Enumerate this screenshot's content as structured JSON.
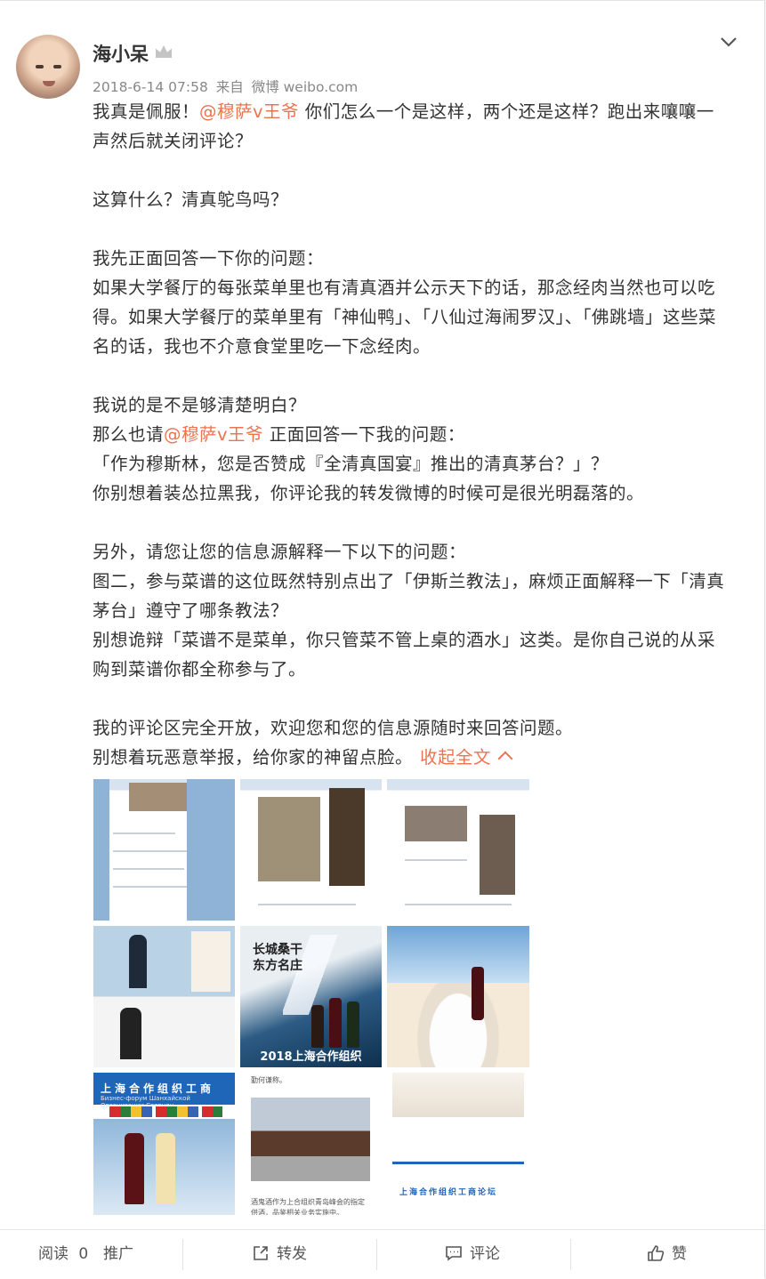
{
  "post": {
    "author": "海小呆",
    "timestamp": "2018-6-14 07:58",
    "source_prefix": "来自",
    "source": "微博 weibo.com",
    "p1_a": "我真是佩服！",
    "mention1": "@穆萨v王爷",
    "p1_b": " 你们怎么一个是这样，两个还是这样？跑出来嚷嚷一声然后就关闭评论？",
    "p2": "这算什么？清真鸵鸟吗？",
    "p3": "我先正面回答一下你的问题：",
    "p4": "如果大学餐厅的每张菜单里也有清真酒并公示天下的话，那念经肉当然也可以吃得。如果大学餐厅的菜单里有「神仙鸭」、「八仙过海闹罗汉」、「佛跳墙」这些菜名的话，我也不介意食堂里吃一下念经肉。",
    "p5": "我说的是不是够清楚明白？",
    "p6_a": "那么也请",
    "mention2": "@穆萨v王爷",
    "p6_b": " 正面回答一下我的问题：",
    "p7": "「作为穆斯林，您是否赞成『全清真国宴』推出的清真茅台？」？",
    "p8": "你别想着装怂拉黑我，你评论我的转发微博的时候可是很光明磊落的。",
    "p9": "另外，请您让您的信息源解释一下以下的问题：",
    "p10": "图二，参与菜谱的这位既然特别点出了「伊斯兰教法」，麻烦正面解释一下「清真茅台」遵守了哪条教法？",
    "p11": "别想诡辩「菜谱不是菜单，你只管菜不管上桌的酒水」这类。是你自己说的从采购到菜谱你都全称参与了。",
    "p12": "我的评论区完全开放，欢迎您和您的信息源随时来回答问题。",
    "p13": "别想着玩恶意举报，给你家的神留点脸。",
    "collapse_label": "收起全文"
  },
  "images": {
    "poster_cn": "长城桑干\n东方名庄",
    "poster_year": "2018上海合作组织",
    "sco_title": "上海合作组织工商",
    "sco_sub": "Бизнес-форум Шанхайской Организации Сотрудн",
    "article_top": "勤何谦称。",
    "article_bottom": "酒鬼酒作为上合组织青岛峰会的指定\n供酒，品鉴相关业务实施中。",
    "mixed_title": "上海合作组织工商论坛"
  },
  "actions": {
    "read_label": "阅读",
    "read_count": "0",
    "promote_label": "推广",
    "share_label": "转发",
    "comment_label": "评论",
    "like_label": "赞"
  },
  "colors": {
    "link": "#eb7350",
    "text": "#333333",
    "meta": "#888888"
  }
}
